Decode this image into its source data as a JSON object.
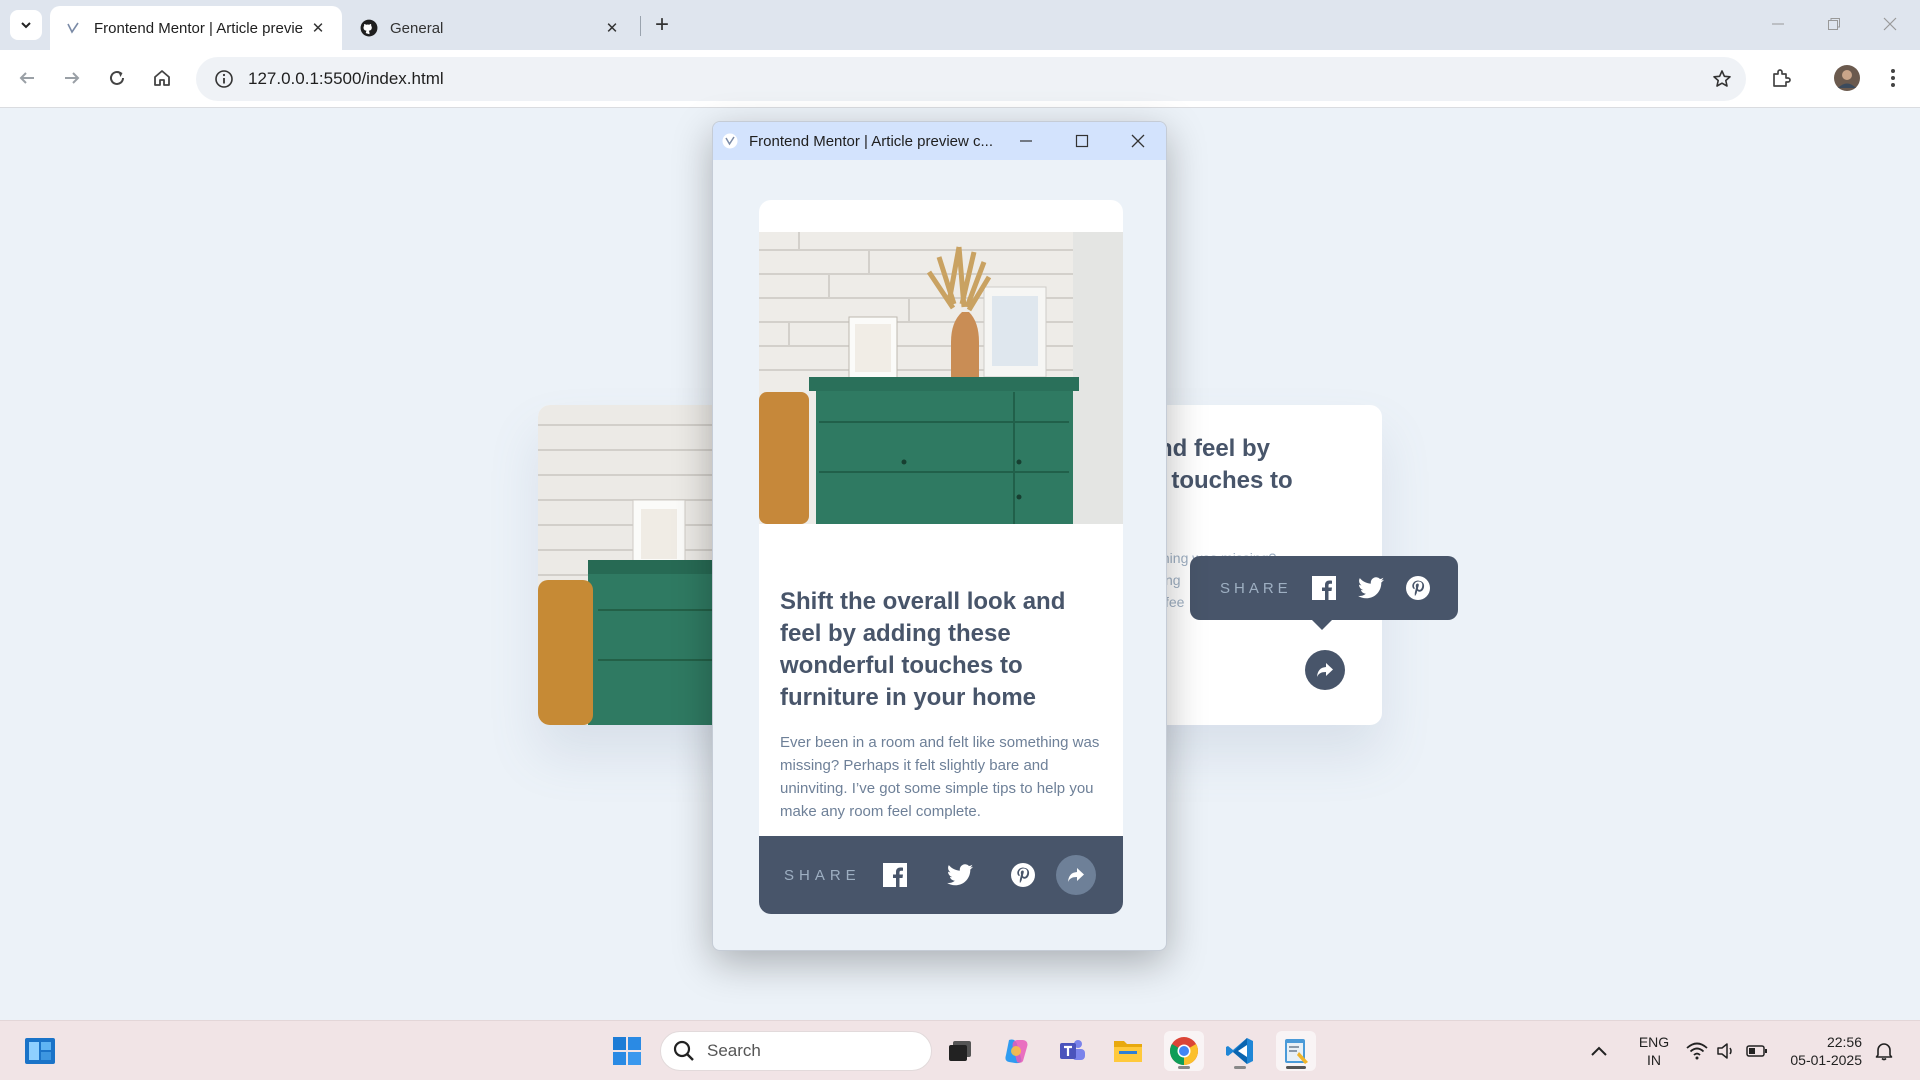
{
  "browser": {
    "tabs": [
      {
        "title": "Frontend Mentor | Article previe",
        "active": true
      },
      {
        "title": "General",
        "active": false
      }
    ],
    "url": "127.0.0.1:5500/index.html"
  },
  "background_page": {
    "heading_fragment_1": "nd feel by",
    "heading_fragment_2": "l touches to",
    "para_fragment_1": "thing was missing?",
    "para_fragment_2": "ting",
    "para_fragment_3": "l fee",
    "tooltip": {
      "share_label": "SHARE"
    }
  },
  "popup": {
    "title": "Frontend Mentor | Article preview c...",
    "card": {
      "heading": "Shift the overall look and feel by adding these wonderful touches to furniture in your home",
      "description": "Ever been in a room and felt like something was missing? Perhaps it felt slightly bare and uninviting. I’ve got some simple tips to help you make any room feel complete.",
      "share_label": "SHARE"
    }
  },
  "taskbar": {
    "search_placeholder": "Search",
    "lang_line1": "ENG",
    "lang_line2": "IN",
    "time": "22:56",
    "date": "05-01-2025"
  },
  "colors": {
    "accent_dark": "#48556a",
    "accent_mid": "#6e8098",
    "accent_light": "#9eafc2",
    "page_bg": "#ecf2f8"
  }
}
